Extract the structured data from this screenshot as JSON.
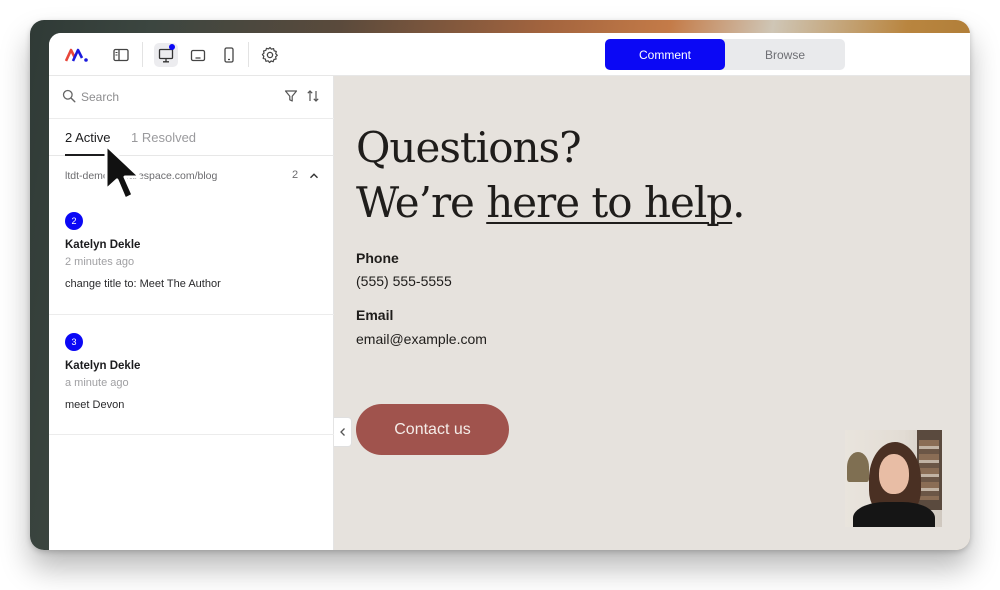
{
  "toolbar": {
    "icons": [
      "logo-icon",
      "sidebar-toggle-icon",
      "desktop-icon",
      "tablet-icon",
      "mobile-icon",
      "settings-icon"
    ],
    "mode": {
      "comment_label": "Comment",
      "browse_label": "Browse",
      "selected": "Comment"
    }
  },
  "sidebar": {
    "search": {
      "placeholder": "Search",
      "value": ""
    },
    "tabs": {
      "active_label": "2 Active",
      "resolved_label": "1 Resolved"
    },
    "page_group": {
      "url": "ltdt-demo.squarespace.com/blog",
      "count": "2"
    },
    "comments": [
      {
        "number": "2",
        "author": "Katelyn Dekle",
        "time": "2 minutes ago",
        "text": "change title to: Meet The Author"
      },
      {
        "number": "3",
        "author": "Katelyn Dekle",
        "time": "a minute ago",
        "text": "meet Devon"
      }
    ]
  },
  "preview": {
    "headline_line1": "Questions?",
    "headline_line2_prefix": "We’re ",
    "headline_link": "here to help",
    "headline_suffix": ".",
    "phone_label": "Phone",
    "phone_value": "(555) 555-5555",
    "email_label": "Email",
    "email_value": "email@example.com",
    "cta_label": "Contact us"
  },
  "colors": {
    "accent": "#0b08f5",
    "cta": "#a0534d",
    "preview_bg": "#e6e2dd"
  }
}
